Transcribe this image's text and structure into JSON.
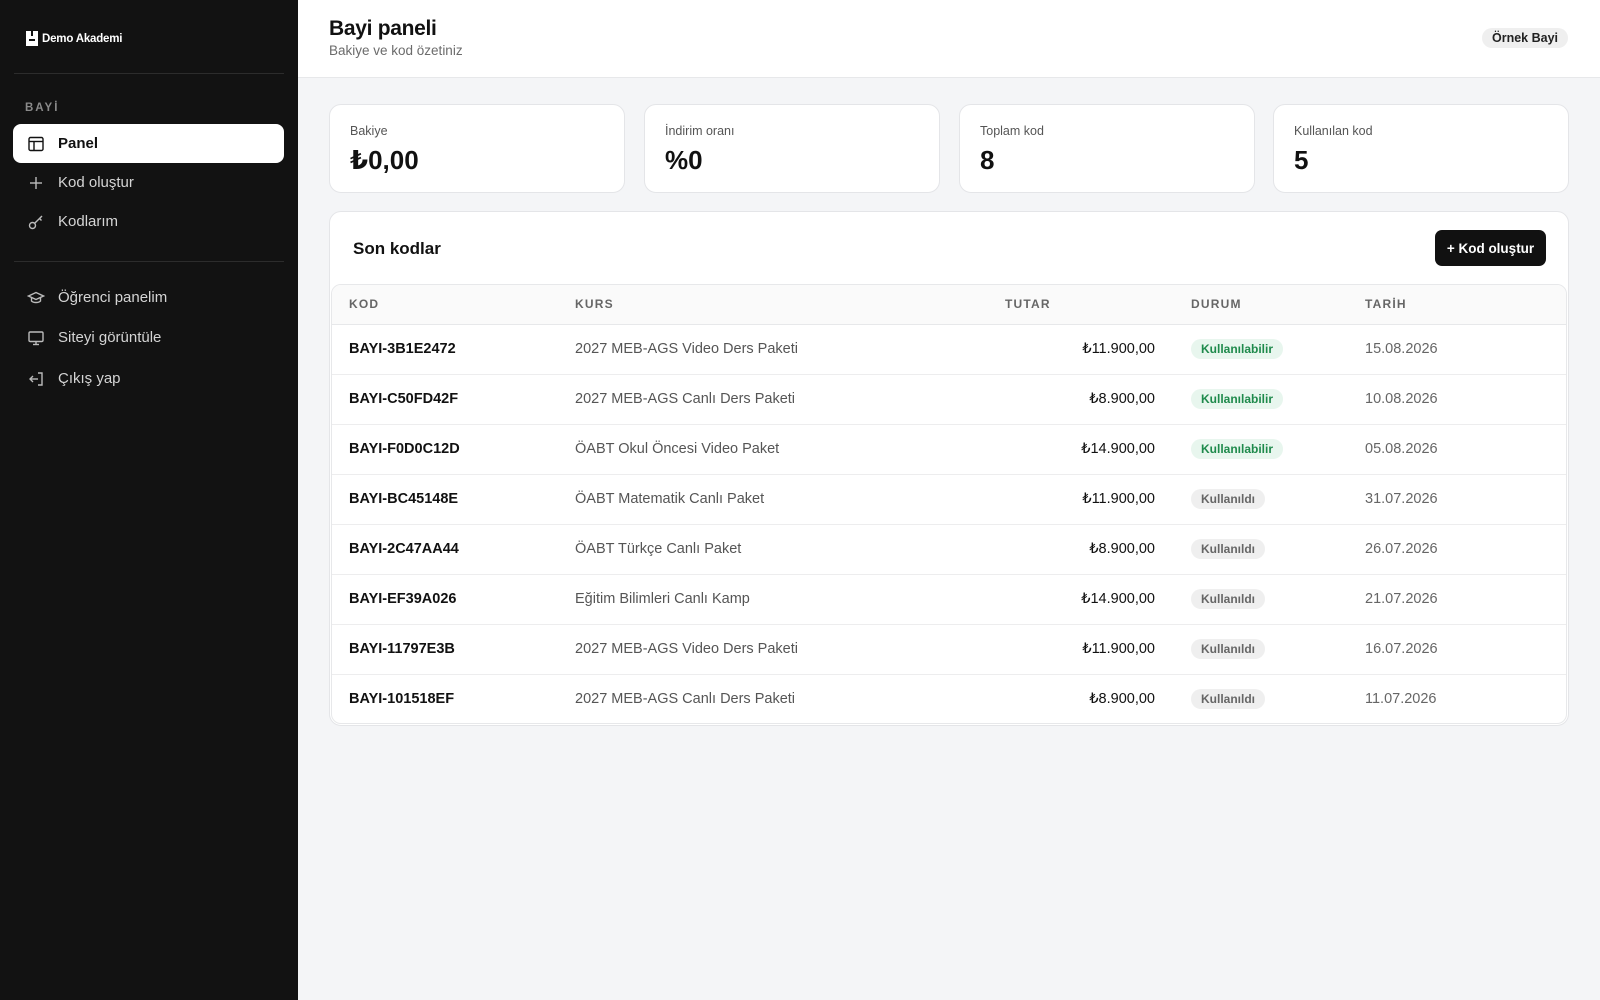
{
  "brand": {
    "name": "Demo Akademi"
  },
  "sidebar": {
    "section_label": "BAYİ",
    "items": [
      {
        "label": "Panel",
        "icon": "layout-icon",
        "active": true
      },
      {
        "label": "Kod oluştur",
        "icon": "plus-icon",
        "active": false
      },
      {
        "label": "Kodlarım",
        "icon": "key-icon",
        "active": false
      }
    ],
    "secondary_items": [
      {
        "label": "Öğrenci panelim",
        "icon": "graduation-cap-icon"
      },
      {
        "label": "Siteyi görüntüle",
        "icon": "monitor-icon"
      },
      {
        "label": "Çıkış yap",
        "icon": "logout-icon"
      }
    ]
  },
  "header": {
    "title": "Bayi paneli",
    "subtitle": "Bakiye ve kod özetiniz",
    "user_badge": "Örnek Bayi"
  },
  "stats": [
    {
      "label": "Bakiye",
      "value": "₺0,00"
    },
    {
      "label": "İndirim oranı",
      "value": "%0"
    },
    {
      "label": "Toplam kod",
      "value": "8"
    },
    {
      "label": "Kullanılan kod",
      "value": "5"
    }
  ],
  "codes": {
    "title": "Son kodlar",
    "new_button_label": "+ Kod oluştur",
    "columns": [
      "KOD",
      "KURS",
      "TUTAR",
      "DURUM",
      "TARİH"
    ],
    "rows": [
      {
        "code": "BAYI-3B1E2472",
        "course": "2027 MEB-AGS Video Ders Paketi",
        "amount": "₺11.900,00",
        "status": "Kullanılabilir",
        "status_type": "available",
        "date": "15.08.2026"
      },
      {
        "code": "BAYI-C50FD42F",
        "course": "2027 MEB-AGS Canlı Ders Paketi",
        "amount": "₺8.900,00",
        "status": "Kullanılabilir",
        "status_type": "available",
        "date": "10.08.2026"
      },
      {
        "code": "BAYI-F0D0C12D",
        "course": "ÖABT Okul Öncesi Video Paket",
        "amount": "₺14.900,00",
        "status": "Kullanılabilir",
        "status_type": "available",
        "date": "05.08.2026"
      },
      {
        "code": "BAYI-BC45148E",
        "course": "ÖABT Matematik Canlı Paket",
        "amount": "₺11.900,00",
        "status": "Kullanıldı",
        "status_type": "used",
        "date": "31.07.2026"
      },
      {
        "code": "BAYI-2C47AA44",
        "course": "ÖABT Türkçe Canlı Paket",
        "amount": "₺8.900,00",
        "status": "Kullanıldı",
        "status_type": "used",
        "date": "26.07.2026"
      },
      {
        "code": "BAYI-EF39A026",
        "course": "Eğitim Bilimleri Canlı Kamp",
        "amount": "₺14.900,00",
        "status": "Kullanıldı",
        "status_type": "used",
        "date": "21.07.2026"
      },
      {
        "code": "BAYI-11797E3B",
        "course": "2027 MEB-AGS Video Ders Paketi",
        "amount": "₺11.900,00",
        "status": "Kullanıldı",
        "status_type": "used",
        "date": "16.07.2026"
      },
      {
        "code": "BAYI-101518EF",
        "course": "2027 MEB-AGS Canlı Ders Paketi",
        "amount": "₺8.900,00",
        "status": "Kullanıldı",
        "status_type": "used",
        "date": "11.07.2026"
      }
    ]
  },
  "colors": {
    "sidebar_bg": "#121212",
    "page_bg": "#f4f5f7",
    "accent": "#111111",
    "available_badge_bg": "#e8f6ee",
    "available_badge_text": "#1f8a4c",
    "used_badge_bg": "#efefef",
    "used_badge_text": "#666666"
  }
}
